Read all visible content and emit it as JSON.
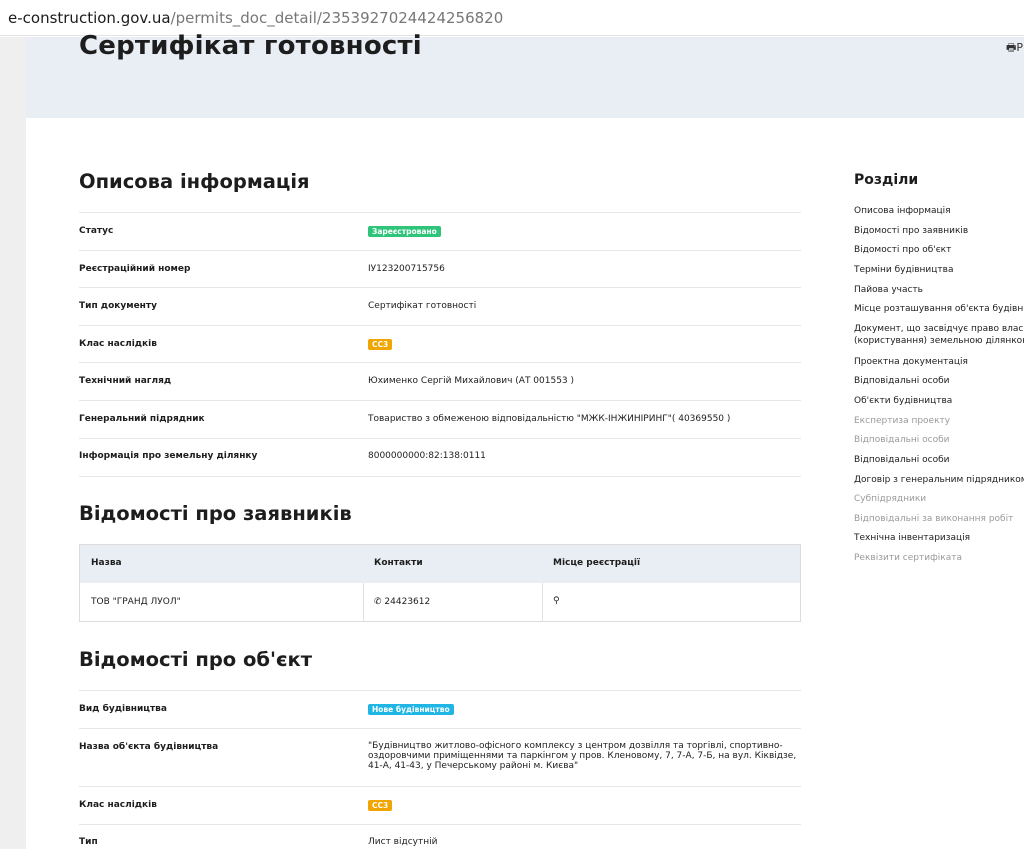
{
  "browser": {
    "url_domain": "e-construction.gov.ua",
    "url_path": "/permits_doc_detail/2353927024424256820"
  },
  "page": {
    "title": "Сертифікат готовності",
    "print_icon": "printer-icon",
    "print_label": "Р"
  },
  "colors": {
    "badge_green": "#2ec47a",
    "badge_orange": "#f0a500",
    "badge_blue": "#1fb6e5"
  },
  "sections": {
    "description": {
      "title": "Описова інформація",
      "rows": [
        {
          "label": "Статус",
          "value": "Зареєстровано",
          "badge": "green"
        },
        {
          "label": "Реєстраційний номер",
          "value": "ІУ123200715756"
        },
        {
          "label": "Тип документу",
          "value": "Сертифікат готовності"
        },
        {
          "label": "Клас наслідків",
          "value": "СС3",
          "badge": "orange"
        },
        {
          "label": "Технічний нагляд",
          "value": "Юхименко Сергій Михайлович (АТ 001553 )"
        },
        {
          "label": "Генеральний підрядник",
          "value": "Товариство з обмеженою відповідальністю \"МЖК-ІНЖИНІРИНГ\"( 40369550 )"
        },
        {
          "label": "Інформація про земельну ділянку",
          "value": "8000000000:82:138:0111"
        }
      ]
    },
    "applicants": {
      "title": "Відомості про заявників",
      "columns": [
        "Назва",
        "Контакти",
        "Місце реєстрації"
      ],
      "rows": [
        {
          "name": "ТОВ \"ГРАНД ЛУОЛ\"",
          "phone": "24423612",
          "location": ""
        }
      ]
    },
    "object": {
      "title": "Відомості про об'єкт",
      "rows": [
        {
          "label": "Вид будівництва",
          "value": "Нове будівництво",
          "badge": "blue"
        },
        {
          "label": "Назва об'єкта будівництва",
          "value": "\"Будівництво житлово-офісного комплексу з центром дозвілля та торгівлі, спортивно-оздоровчими приміщеннями та паркінгом у пров. Кленовому, 7, 7-А, 7-Б, на вул. Кіквідзе, 41-А, 41-43, у Печерському районі м. Києва\""
        },
        {
          "label": "Клас наслідків",
          "value": "СС3",
          "badge": "orange"
        },
        {
          "label": "Тип",
          "value": "Лист відсутній"
        }
      ]
    }
  },
  "sidebar": {
    "title": "Розділи",
    "items": [
      {
        "label": "Описова інформація",
        "muted": false
      },
      {
        "label": "Відомості про заявників",
        "muted": false
      },
      {
        "label": "Відомості про об'єкт",
        "muted": false
      },
      {
        "label": "Терміни будівництва",
        "muted": false
      },
      {
        "label": "Пайова участь",
        "muted": false
      },
      {
        "label": "Місце розташування об'єкта будівництва",
        "muted": false
      },
      {
        "label": "Документ, що засвідчує право власності",
        "label2": "(користування) земельною ділянкою",
        "muted": false
      },
      {
        "label": "Проектна документація",
        "muted": false
      },
      {
        "label": "Відповідальні особи",
        "muted": false
      },
      {
        "label": "Об'єкти будівництва",
        "muted": false
      },
      {
        "label": "Експертиза проекту",
        "muted": true
      },
      {
        "label": "Відповідальні особи",
        "muted": true
      },
      {
        "label": "Відповідальні особи",
        "muted": false
      },
      {
        "label": "Договір з генеральним підрядником",
        "muted": false
      },
      {
        "label": "Субпідрядники",
        "muted": true
      },
      {
        "label": "Відповідальні за виконання робіт",
        "muted": true
      },
      {
        "label": "Технічна інвентаризація",
        "muted": false
      },
      {
        "label": "Реквізити сертифіката",
        "muted": true
      }
    ]
  }
}
